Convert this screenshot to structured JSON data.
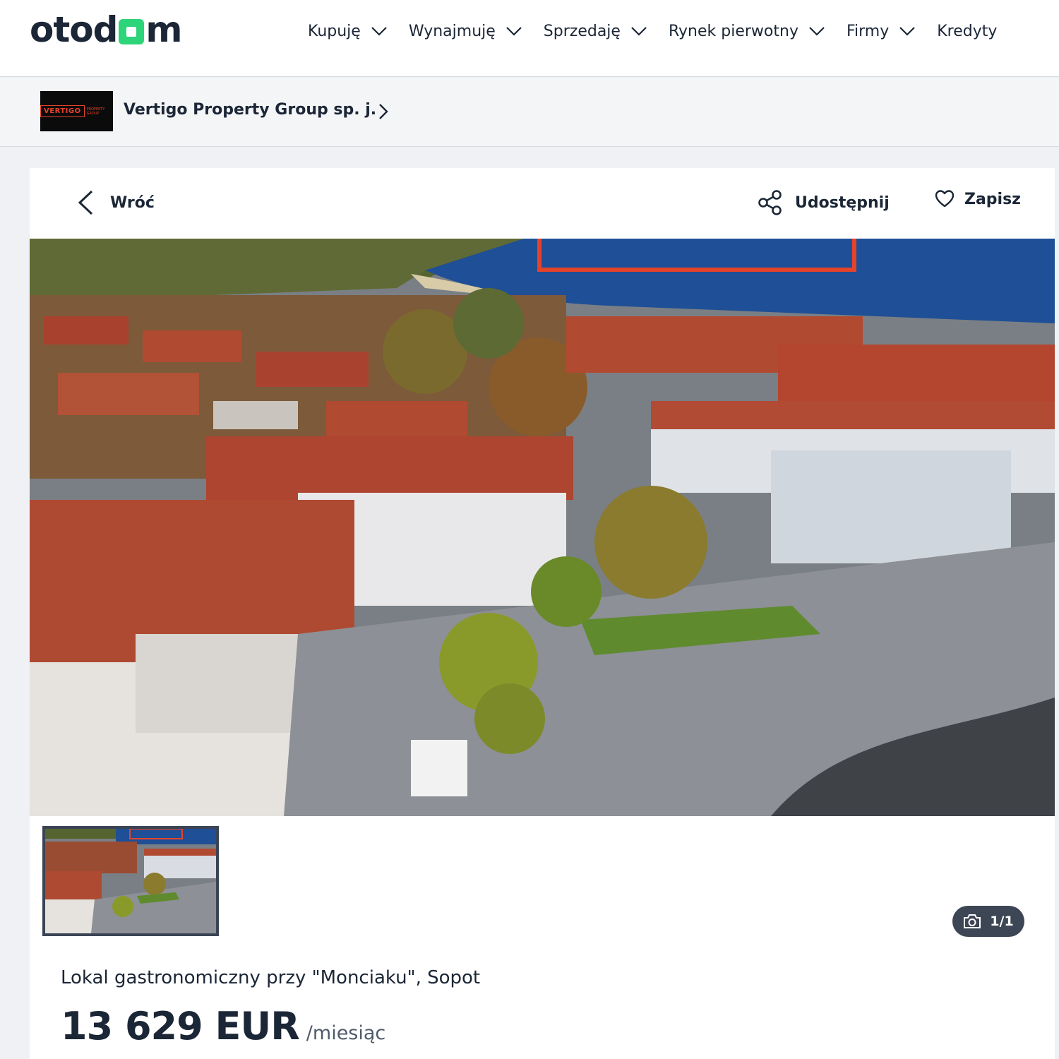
{
  "header": {
    "logo_left": "otod",
    "logo_right": "m",
    "nav": [
      {
        "label": "Kupuję",
        "dropdown": true
      },
      {
        "label": "Wynajmuję",
        "dropdown": true
      },
      {
        "label": "Sprzedaję",
        "dropdown": true
      },
      {
        "label": "Rynek pierwotny",
        "dropdown": true
      },
      {
        "label": "Firmy",
        "dropdown": true
      },
      {
        "label": "Kredyty",
        "dropdown": false
      }
    ]
  },
  "agency": {
    "logo_text": "VERTIGO",
    "logo_small": "PROPERTY GROUP",
    "name": "Vertigo Property Group sp. j."
  },
  "actions": {
    "back_label": "Wróć",
    "share_label": "Udostępnij",
    "save_label": "Zapisz"
  },
  "gallery": {
    "counter": "1/1",
    "icon": "camera-icon"
  },
  "listing": {
    "title": "Lokal gastronomiczny przy \"Monciaku\", Sopot",
    "price": "13 629 EUR",
    "price_period": "/miesiąc"
  },
  "colors": {
    "brand_green": "#2ed47a",
    "text_dark": "#1b2636",
    "vertigo_orange": "#e5432a"
  }
}
